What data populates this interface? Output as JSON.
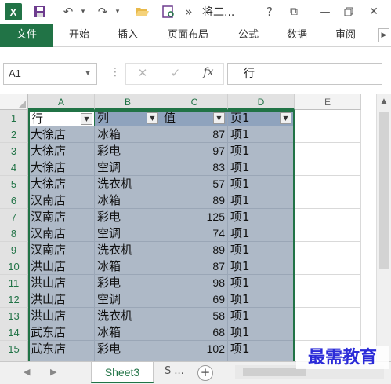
{
  "app": {
    "logo_letter": "X",
    "title": "将二..."
  },
  "titlebar": {
    "save_icon": "floppy-disk-icon",
    "undo_icon": "undo-icon",
    "redo_icon": "redo-icon",
    "open_icon": "folder-open-icon",
    "print_preview_icon": "print-preview-icon",
    "more_symbol": "»",
    "help_symbol": "?",
    "restore_symbol": "⧉",
    "minimize_symbol": "—",
    "close_symbol": "✕"
  },
  "ribbon": {
    "tabs": [
      "文件",
      "开始",
      "插入",
      "页面布局",
      "公式",
      "数据",
      "审阅"
    ],
    "active_color": "#217346"
  },
  "formula_bar": {
    "name_box": "A1",
    "cancel_symbol": "✕",
    "enter_symbol": "✓",
    "fx_label": "fx",
    "value": "行"
  },
  "columns": [
    "A",
    "B",
    "C",
    "D",
    "E"
  ],
  "rows": [
    "1",
    "2",
    "3",
    "4",
    "5",
    "6",
    "7",
    "8",
    "9",
    "10",
    "11",
    "12",
    "13",
    "14",
    "15"
  ],
  "table": {
    "headers": [
      "行",
      "列",
      "值",
      "页1"
    ],
    "rows": [
      [
        "大徐店",
        "冰箱",
        "87",
        "项1"
      ],
      [
        "大徐店",
        "彩电",
        "97",
        "项1"
      ],
      [
        "大徐店",
        "空调",
        "83",
        "项1"
      ],
      [
        "大徐店",
        "洗衣机",
        "57",
        "项1"
      ],
      [
        "汉南店",
        "冰箱",
        "89",
        "项1"
      ],
      [
        "汉南店",
        "彩电",
        "125",
        "项1"
      ],
      [
        "汉南店",
        "空调",
        "74",
        "项1"
      ],
      [
        "汉南店",
        "洗衣机",
        "89",
        "项1"
      ],
      [
        "洪山店",
        "冰箱",
        "87",
        "项1"
      ],
      [
        "洪山店",
        "彩电",
        "98",
        "项1"
      ],
      [
        "洪山店",
        "空调",
        "69",
        "项1"
      ],
      [
        "洪山店",
        "洗衣机",
        "58",
        "项1"
      ],
      [
        "武东店",
        "冰箱",
        "68",
        "项1"
      ],
      [
        "武东店",
        "彩电",
        "102",
        "项1"
      ]
    ]
  },
  "sheets": {
    "active": "Sheet3",
    "more": "S ...",
    "add_symbol": "+",
    "prev_symbol": "◀",
    "next_symbol": "▶"
  },
  "watermark": "最需教育"
}
